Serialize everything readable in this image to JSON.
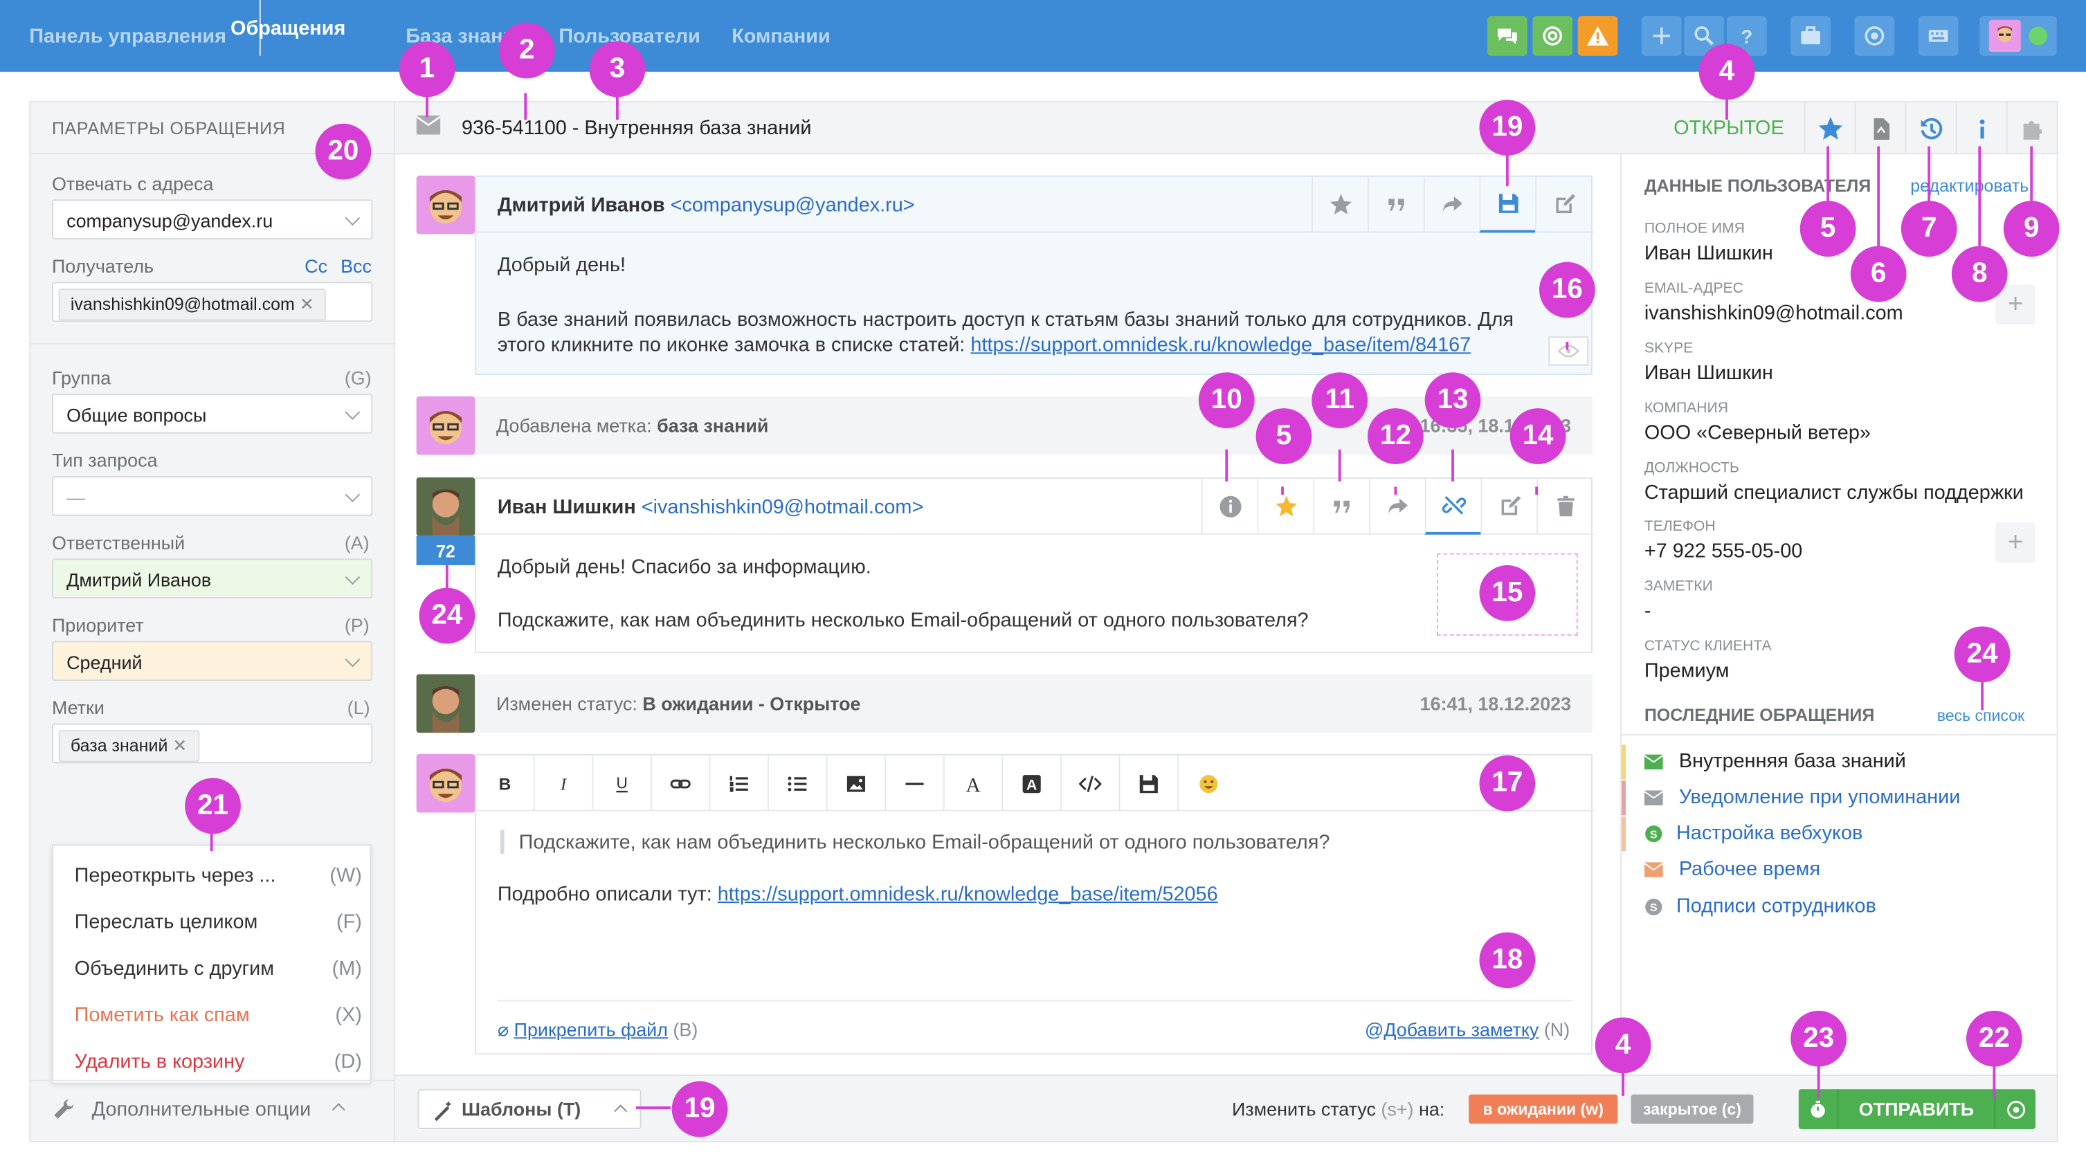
{
  "nav": {
    "items": [
      "Панель управления",
      "Обращения",
      "База знаний",
      "Пользователи",
      "Компании"
    ],
    "active": "Обращения"
  },
  "ticket": {
    "id_title": "936-541100 - Внутренняя база знаний",
    "status": "ОТКРЫТОЕ"
  },
  "left": {
    "title": "ПАРАМЕТРЫ ОБРАЩЕНИЯ",
    "reply_from_label": "Отвечать с адреса",
    "reply_from_value": "companysup@yandex.ru",
    "recipient_label": "Получатель",
    "cc": "Cc",
    "bcc": "Bcc",
    "recipient_value": "ivanshishkin09@hotmail.com",
    "group_label": "Группа",
    "group_key": "(G)",
    "group_value": "Общие вопросы",
    "type_label": "Тип запроса",
    "type_value": "—",
    "assignee_label": "Ответственный",
    "assignee_key": "(A)",
    "assignee_value": "Дмитрий Иванов",
    "priority_label": "Приоритет",
    "priority_key": "(P)",
    "priority_value": "Средний",
    "tags_label": "Метки",
    "tags_key": "(L)",
    "tags_value": "база знаний",
    "menu": [
      {
        "label": "Переоткрыть через ...",
        "key": "(W)",
        "color": "#333333"
      },
      {
        "label": "Переслать целиком",
        "key": "(F)",
        "color": "#333333"
      },
      {
        "label": "Объединить с другим",
        "key": "(M)",
        "color": "#333333"
      },
      {
        "label": "Пометить как спам",
        "key": "(X)",
        "color": "#e8734f"
      },
      {
        "label": "Удалить в корзину",
        "key": "(D)",
        "color": "#d9363e"
      }
    ],
    "more_options": "Дополнительные опции"
  },
  "messages": {
    "m1_name": "Дмитрий Иванов",
    "m1_email": "<companysup@yandex.ru>",
    "m1_line1": "Добрый день!",
    "m1_line2": "В базе знаний появилась возможность настроить доступ к статьям базы знаний только для сотрудников. Для",
    "m1_line3_pre": "этого кликните по иконке замочка в списке статей: ",
    "m1_link": "https://support.omnidesk.ru/knowledge_base/item/84167",
    "event1_label": "Добавлена метка:",
    "event1_value": "база знаний",
    "event1_time": "16:35, 18.12.2023",
    "m2_name": "Иван Шишкин",
    "m2_email": "<ivanshishkin09@hotmail.com>",
    "m2_count": "72",
    "m2_line1": "Добрый день! Спасибо за информацию.",
    "m2_line2": "Подскажите, как нам объединить несколько Email-обращений от одного пользователя?",
    "event2_label": "Изменен статус:",
    "event2_value": "В ожидании - Открытое",
    "event2_time": "16:41, 18.12.2023"
  },
  "editor": {
    "quote": "Подскажите, как нам объединить несколько Email-обращений от одного пользователя?",
    "body_pre": "Подробно описали тут: ",
    "body_link": "https://support.omnidesk.ru/knowledge_base/item/52056",
    "attach": "Прикрепить файл",
    "attach_key": "(B)",
    "note": "Добавить заметку",
    "note_key": "(N)"
  },
  "footer": {
    "templates": "Шаблоны (T)",
    "change_status": "Изменить статус",
    "change_status_key": "(s+)",
    "change_status_on": "на:",
    "pending": "в ожидании (w)",
    "closed": "закрытое (c)",
    "send": "ОТПРАВИТЬ"
  },
  "user": {
    "title": "ДАННЫЕ ПОЛЬЗОВАТЕЛЯ",
    "edit": "редактировать",
    "full_name_label": "ПОЛНОЕ ИМЯ",
    "full_name": "Иван Шишкин",
    "email_label": "EMAIL-АДРЕС",
    "email": "ivanshishkin09@hotmail.com",
    "skype_label": "SKYPE",
    "skype": "Иван Шишкин",
    "company_label": "КОМПАНИЯ",
    "company": "ООО «Северный ветер»",
    "position_label": "ДОЛЖНОСТЬ",
    "position": "Старший специалист службы поддержки",
    "phone_label": "ТЕЛЕФОН",
    "phone": "+7 922 555-05-00",
    "notes_label": "ЗАМЕТКИ",
    "notes": "-",
    "status_label": "СТАТУС КЛИЕНТА",
    "status": "Премиум",
    "recent_title": "ПОСЛЕДНИЕ ОБРАЩЕНИЯ",
    "recent_all": "весь список",
    "recent": [
      {
        "title": "Внутренняя база знаний",
        "icon": "mail-icon",
        "color": "#4caf50"
      },
      {
        "title": "Уведомление при упоминании",
        "icon": "mail-icon",
        "color": "#9aa0a6"
      },
      {
        "title": "Настройка вебхуков",
        "icon": "skype-icon",
        "color": "#4caf50"
      },
      {
        "title": "Рабочее время",
        "icon": "mail-icon",
        "color": "#f0a070"
      },
      {
        "title": "Подписи сотрудников",
        "icon": "skype-icon",
        "color": "#9aa0a6"
      }
    ]
  },
  "badges": [
    "1",
    "2",
    "3",
    "4",
    "5",
    "6",
    "7",
    "8",
    "9",
    "10",
    "5",
    "11",
    "12",
    "13",
    "14",
    "15",
    "16",
    "17",
    "18",
    "19",
    "20",
    "21",
    "22",
    "23",
    "24",
    "24",
    "19",
    "4"
  ],
  "colors": {
    "accent": "#3d8bd6",
    "badge": "#d63ed6",
    "green": "#4caf50",
    "orange": "#f07f58",
    "gray": "#a8aaad"
  }
}
